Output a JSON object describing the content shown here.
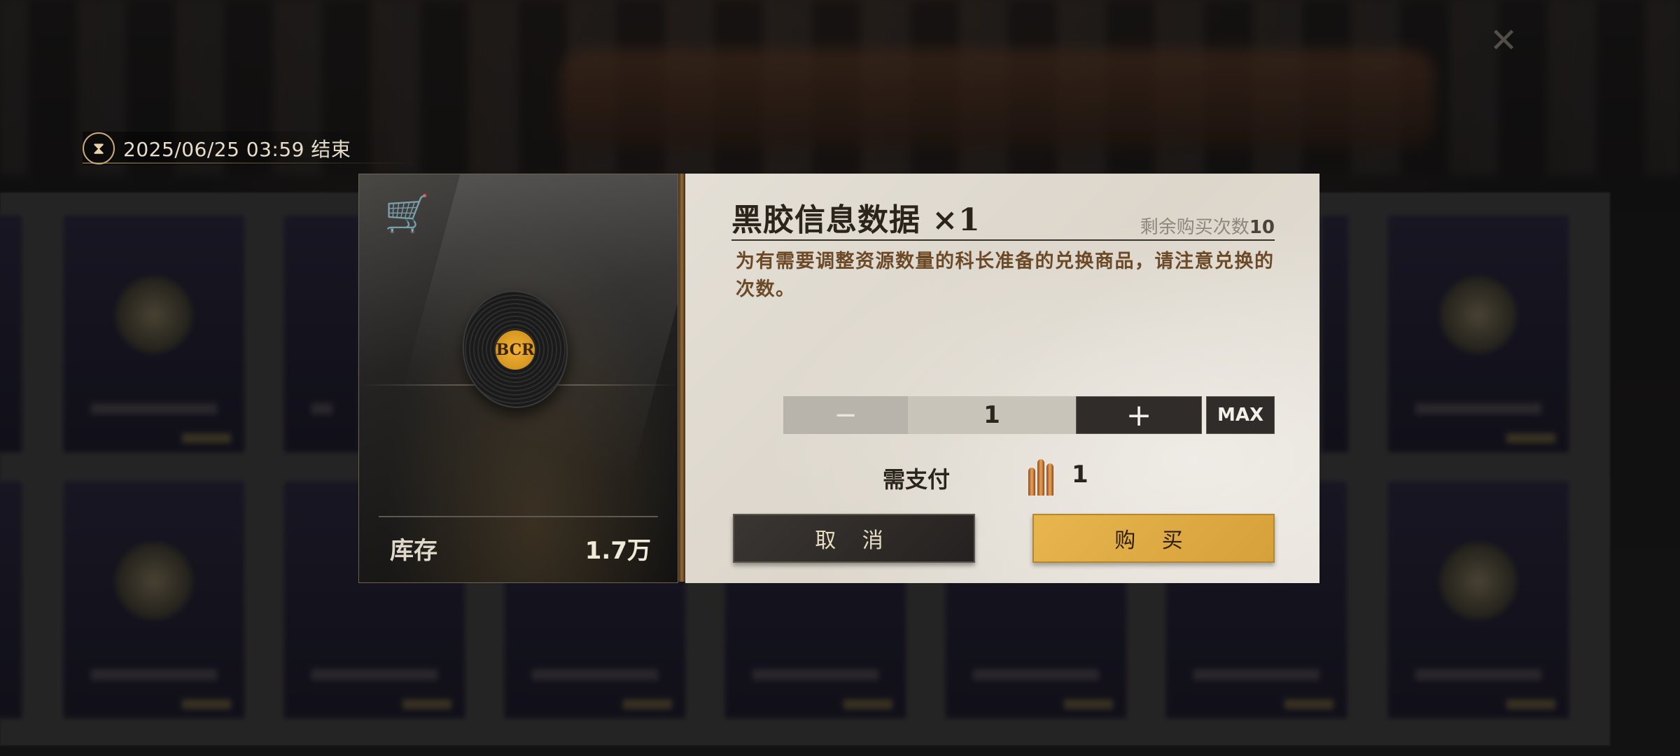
{
  "timer": {
    "icon": "hourglass-icon",
    "text": "2025/06/25 03:59 结束"
  },
  "item": {
    "title": "黑胶信息数据 ×1",
    "remaining_label": "剩余购买次数",
    "remaining_value": "10",
    "description": "为有需要调整资源数量的科长准备的兑换商品，请注意兑换的次数。",
    "image_icon": "vinyl-record-icon",
    "record_label": "BCR"
  },
  "stock": {
    "label": "库存",
    "value": "1.7万"
  },
  "quantity": {
    "minus_label": "−",
    "value": "1",
    "plus_label": "+",
    "max_label": "MAX"
  },
  "payment": {
    "label": "需支付",
    "currency_icon": "bullet-currency-icon",
    "amount": "1"
  },
  "buttons": {
    "cancel": "取 消",
    "buy": "购 买"
  },
  "colors": {
    "accent_gold": "#e3ae45",
    "panel_bg": "#e0dbd2",
    "desc_text": "#6c4a28"
  }
}
